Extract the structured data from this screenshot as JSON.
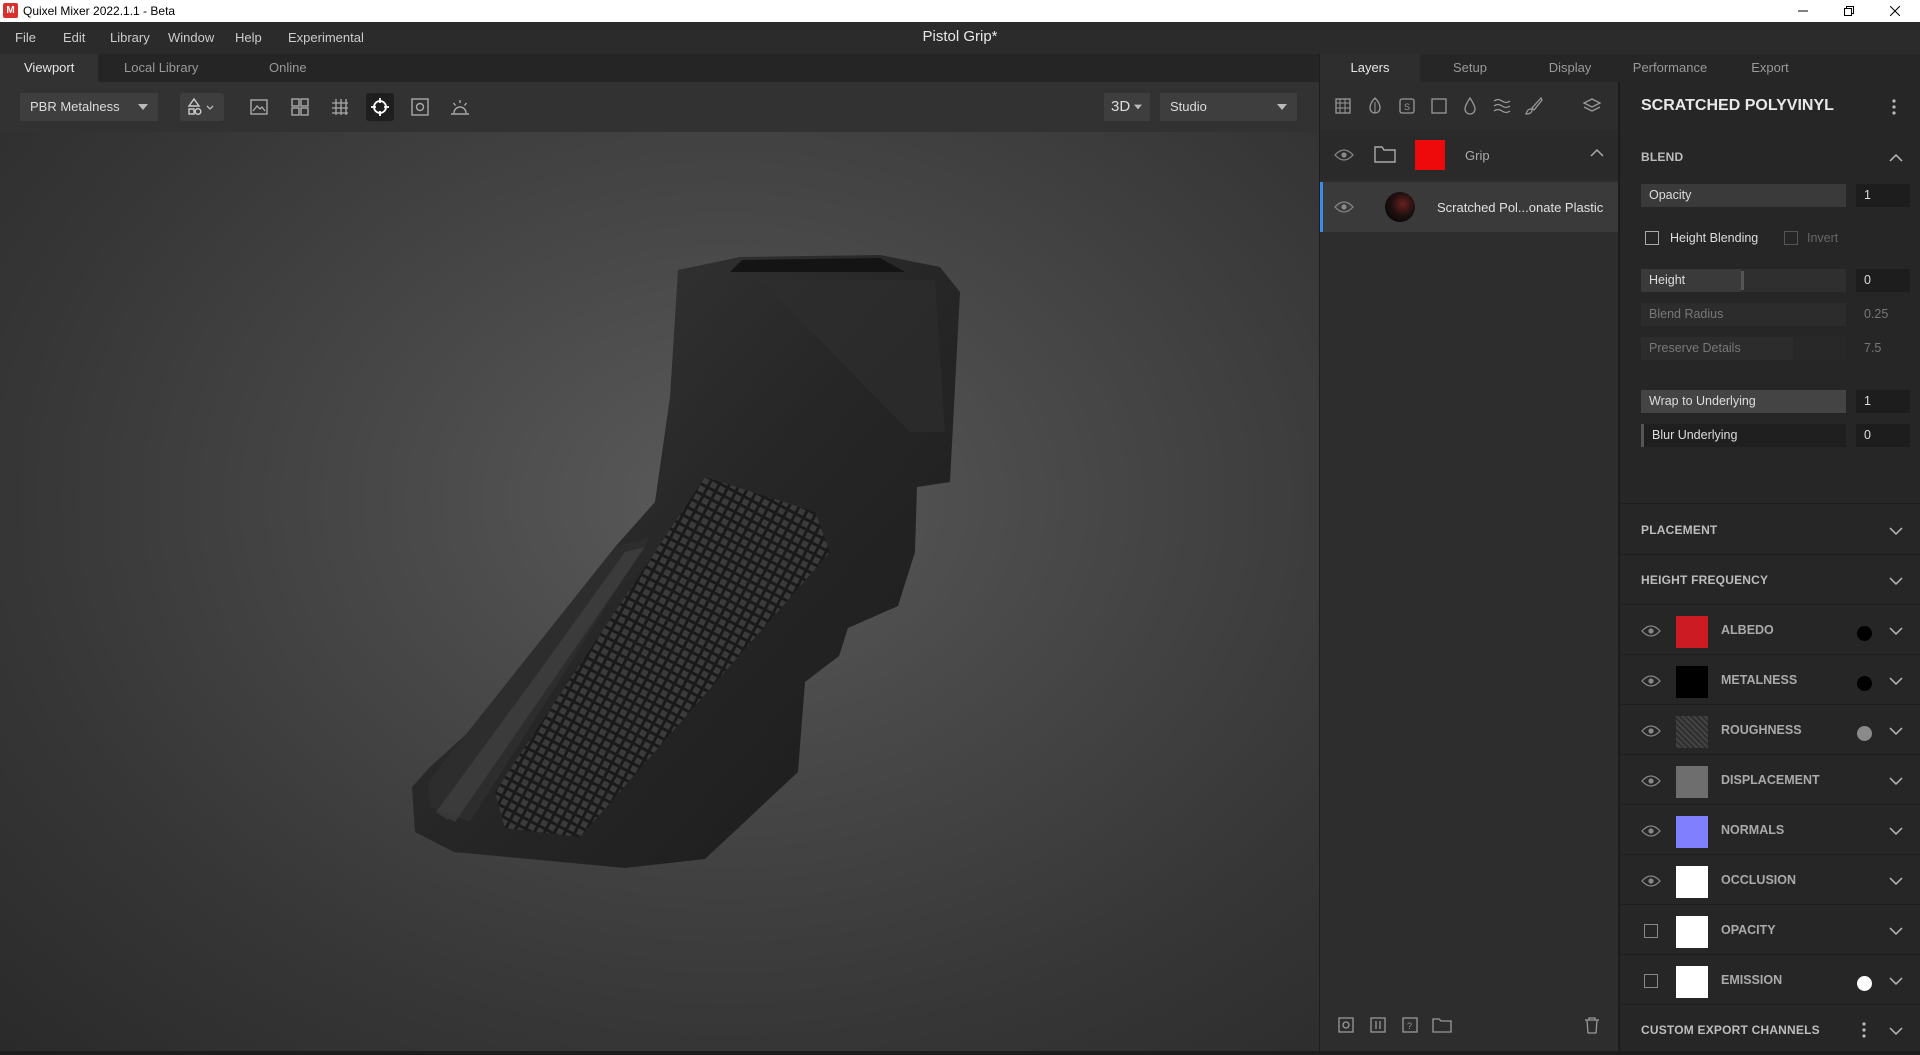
{
  "window": {
    "title": "Quixel Mixer 2022.1.1 - Beta",
    "app_icon": "M"
  },
  "menu": [
    "File",
    "Edit",
    "Library",
    "Window",
    "Help",
    "Experimental"
  ],
  "document_title": "Pistol Grip*",
  "viewport_tabs": [
    "Viewport",
    "Local Library",
    "Online"
  ],
  "toolbar": {
    "shading_mode": "PBR Metalness",
    "view_mode": "3D",
    "environment": "Studio"
  },
  "right_tabs": [
    "Layers",
    "Setup",
    "Display",
    "Performance",
    "Export"
  ],
  "layers": [
    {
      "name": "Grip",
      "type": "folder"
    },
    {
      "name": "Scratched Pol...onate Plastic",
      "type": "surface"
    }
  ],
  "properties": {
    "title": "SCRATCHED POLYVINYL",
    "blend": {
      "section": "BLEND",
      "opacity_label": "Opacity",
      "opacity_value": "1",
      "height_blending_label": "Height Blending",
      "invert_label": "Invert",
      "height_label": "Height",
      "height_value": "0",
      "blend_radius_label": "Blend Radius",
      "blend_radius_value": "0.25",
      "preserve_details_label": "Preserve Details",
      "preserve_details_value": "7.5",
      "wrap_label": "Wrap to Underlying",
      "wrap_value": "1",
      "blur_label": "Blur Underlying",
      "blur_value": "0"
    },
    "placement": "PLACEMENT",
    "height_frequency": "HEIGHT FREQUENCY",
    "channels": [
      {
        "name": "ALBEDO",
        "color": "#cc1b22",
        "visible": true,
        "dot": "#000000"
      },
      {
        "name": "METALNESS",
        "color": "#000000",
        "visible": true,
        "dot": "#000000"
      },
      {
        "name": "ROUGHNESS",
        "color": "#3a3a3a",
        "visible": true,
        "dot": "#8a8a8a"
      },
      {
        "name": "DISPLACEMENT",
        "color": "#6e6e6e",
        "visible": true,
        "dot": null
      },
      {
        "name": "NORMALS",
        "color": "#8080ff",
        "visible": true,
        "dot": null
      },
      {
        "name": "OCCLUSION",
        "color": "#ffffff",
        "visible": true,
        "dot": null
      },
      {
        "name": "OPACITY",
        "color": "#ffffff",
        "visible": false,
        "dot": null
      },
      {
        "name": "EMISSION",
        "color": "#ffffff",
        "visible": false,
        "dot": "#ffffff"
      }
    ],
    "custom_export": "CUSTOM EXPORT CHANNELS"
  }
}
